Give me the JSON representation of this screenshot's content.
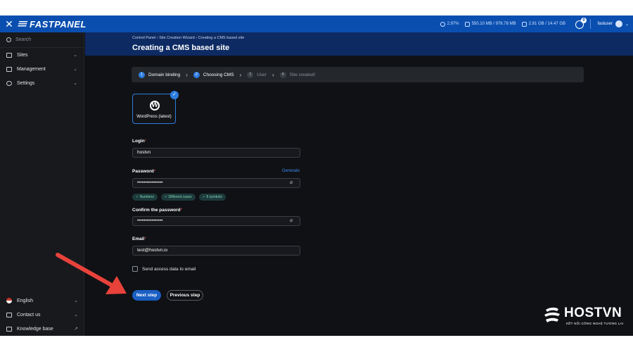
{
  "topbar": {
    "brand": "FASTPANEL",
    "stats": {
      "cpu": "2.97%",
      "ram": "550.10 MB / 976.78 MB",
      "disk": "2.81 GB / 14.47 GB"
    },
    "notifications_count": "0",
    "username": "fastuser"
  },
  "sidebar": {
    "search_placeholder": "Search",
    "items": [
      {
        "label": "Sites"
      },
      {
        "label": "Management"
      },
      {
        "label": "Settings"
      }
    ],
    "bottom_items": [
      {
        "label": "English"
      },
      {
        "label": "Contact us"
      },
      {
        "label": "Knowledge base"
      }
    ]
  },
  "header": {
    "breadcrumb": [
      "Control Panel",
      "Site Creation Wizard",
      "Creating a CMS based site"
    ],
    "title": "Creating a CMS based site"
  },
  "steps": [
    {
      "num": "1",
      "label": "Domain binding",
      "active": true
    },
    {
      "num": "2",
      "label": "Choosing CMS",
      "active": true
    },
    {
      "num": "3",
      "label": "User",
      "active": false
    },
    {
      "num": "4",
      "label": "Site created!",
      "active": false
    }
  ],
  "cms": {
    "label": "WordPress (latest)"
  },
  "form": {
    "login_label": "Login",
    "login_value": "hostvn",
    "password_label": "Password",
    "generate_label": "Generate",
    "password_value": "••••••••••••••••",
    "requirements": [
      "Numbers",
      "Different cases",
      "8 symbols"
    ],
    "confirm_label": "Confirm the password",
    "confirm_value": "••••••••••••••••",
    "email_label": "Email",
    "email_value": "test@hostvn.io",
    "send_access_label": "Send access data to email",
    "next_label": "Next step",
    "prev_label": "Previous step"
  },
  "watermark": {
    "brand": "HOSTVN",
    "tagline": "KẾT NỐI CÔNG NGHỆ TƯƠNG LAI"
  },
  "colors": {
    "accent": "#2e7de0",
    "topbar": "#0a4fb0",
    "header": "#0d2a63",
    "arrow": "#e8423b"
  }
}
